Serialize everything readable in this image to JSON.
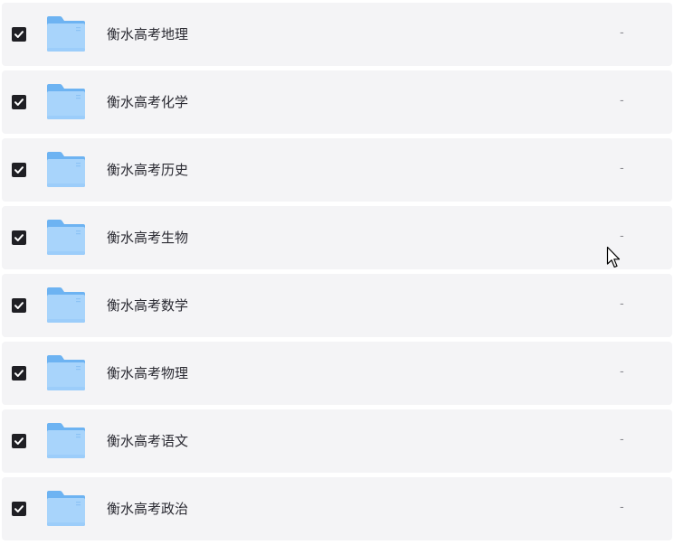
{
  "folders": [
    {
      "name": "衡水高考地理",
      "size": "-",
      "checked": true
    },
    {
      "name": "衡水高考化学",
      "size": "-",
      "checked": true
    },
    {
      "name": "衡水高考历史",
      "size": "-",
      "checked": true
    },
    {
      "name": "衡水高考生物",
      "size": "-",
      "checked": true
    },
    {
      "name": "衡水高考数学",
      "size": "-",
      "checked": true
    },
    {
      "name": "衡水高考物理",
      "size": "-",
      "checked": true
    },
    {
      "name": "衡水高考语文",
      "size": "-",
      "checked": true
    },
    {
      "name": "衡水高考政治",
      "size": "-",
      "checked": true
    }
  ],
  "icons": {
    "checkbox": "checkbox-checked-icon",
    "folder": "folder-icon",
    "cursor": "mouse-cursor-icon"
  },
  "colors": {
    "row_background": "#f4f4f6",
    "checkbox_fill": "#1f1f24",
    "folder_front": "#a8d4fb",
    "folder_back": "#6db3f2"
  }
}
